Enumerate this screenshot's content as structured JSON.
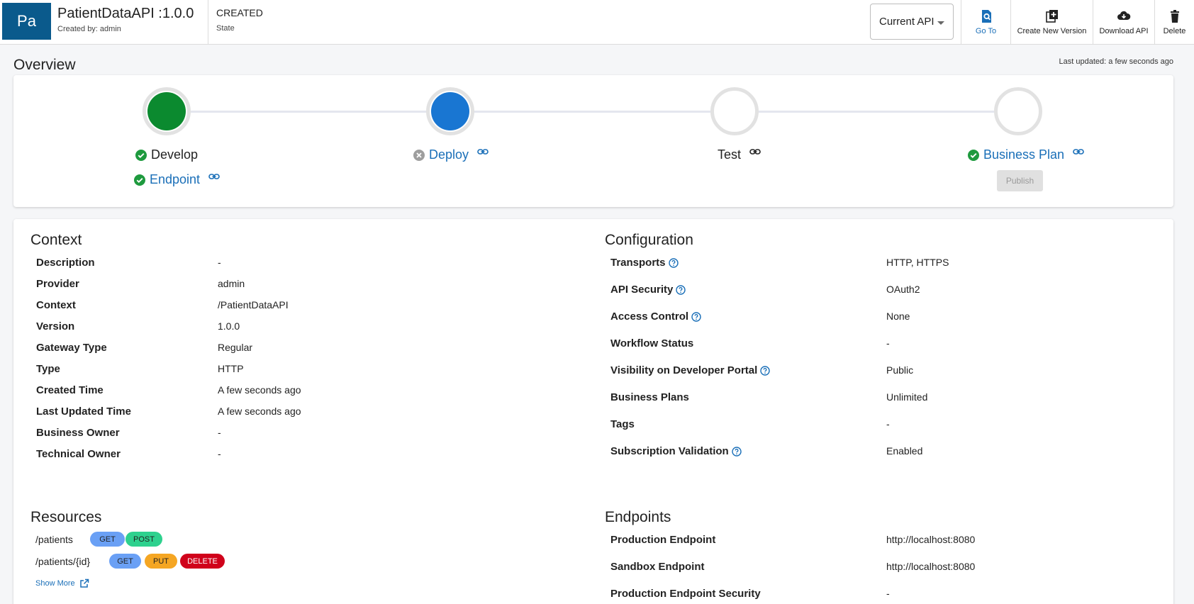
{
  "header": {
    "avatar_text": "Pa",
    "api_name": "PatientDataAPI :1.0.0",
    "created_by": "Created by: admin",
    "state_value": "CREATED",
    "state_label": "State",
    "version_select": "Current API",
    "buttons": {
      "goto": "Go To",
      "create_version": "Create New Version",
      "download": "Download API",
      "delete": "Delete"
    }
  },
  "overview": {
    "title": "Overview",
    "last_updated": "Last updated: a few seconds ago",
    "steps": {
      "develop": "Develop",
      "endpoint": "Endpoint",
      "deploy": "Deploy",
      "test": "Test",
      "business_plan": "Business Plan",
      "publish": "Publish"
    },
    "colors": {
      "develop": "#0b8a2f",
      "deploy": "#1976d2",
      "check": "#1e9a3e",
      "link": "#1a6fb8"
    }
  },
  "context": {
    "title": "Context",
    "rows": [
      {
        "key": "Description",
        "value": "-"
      },
      {
        "key": "Provider",
        "value": "admin"
      },
      {
        "key": "Context",
        "value": "/PatientDataAPI"
      },
      {
        "key": "Version",
        "value": "1.0.0"
      },
      {
        "key": "Gateway Type",
        "value": "Regular"
      },
      {
        "key": "Type",
        "value": "HTTP"
      },
      {
        "key": "Created Time",
        "value": "A few seconds ago"
      },
      {
        "key": "Last Updated Time",
        "value": "A few seconds ago"
      },
      {
        "key": "Business Owner",
        "value": "-"
      },
      {
        "key": "Technical Owner",
        "value": "-"
      }
    ]
  },
  "configuration": {
    "title": "Configuration",
    "rows": [
      {
        "key": "Transports",
        "value": "HTTP, HTTPS"
      },
      {
        "key": "API Security",
        "value": "OAuth2"
      },
      {
        "key": "Access Control",
        "value": "None"
      },
      {
        "key": "Workflow Status",
        "value": "-"
      },
      {
        "key": "Visibility on Developer Portal",
        "value": "Public"
      },
      {
        "key": "Business Plans",
        "value": "Unlimited"
      },
      {
        "key": "Tags",
        "value": "-"
      },
      {
        "key": "Subscription Validation",
        "value": "Enabled"
      }
    ]
  },
  "resources": {
    "title": "Resources",
    "items": [
      {
        "path": "/patients",
        "methods": [
          "GET",
          "POST"
        ]
      },
      {
        "path": "/patients/{id}",
        "methods": [
          "GET",
          "PUT",
          "DELETE"
        ]
      }
    ],
    "show_more": "Show More",
    "method_colors": {
      "GET": "#6aa0f5",
      "POST": "#2ed18e",
      "PUT": "#f5a623",
      "DELETE": "#d0021b"
    }
  },
  "endpoints": {
    "title": "Endpoints",
    "rows": [
      {
        "key": "Production Endpoint",
        "value": "http://localhost:8080"
      },
      {
        "key": "Sandbox Endpoint",
        "value": "http://localhost:8080"
      },
      {
        "key": "Production Endpoint Security",
        "value": "-"
      }
    ]
  }
}
